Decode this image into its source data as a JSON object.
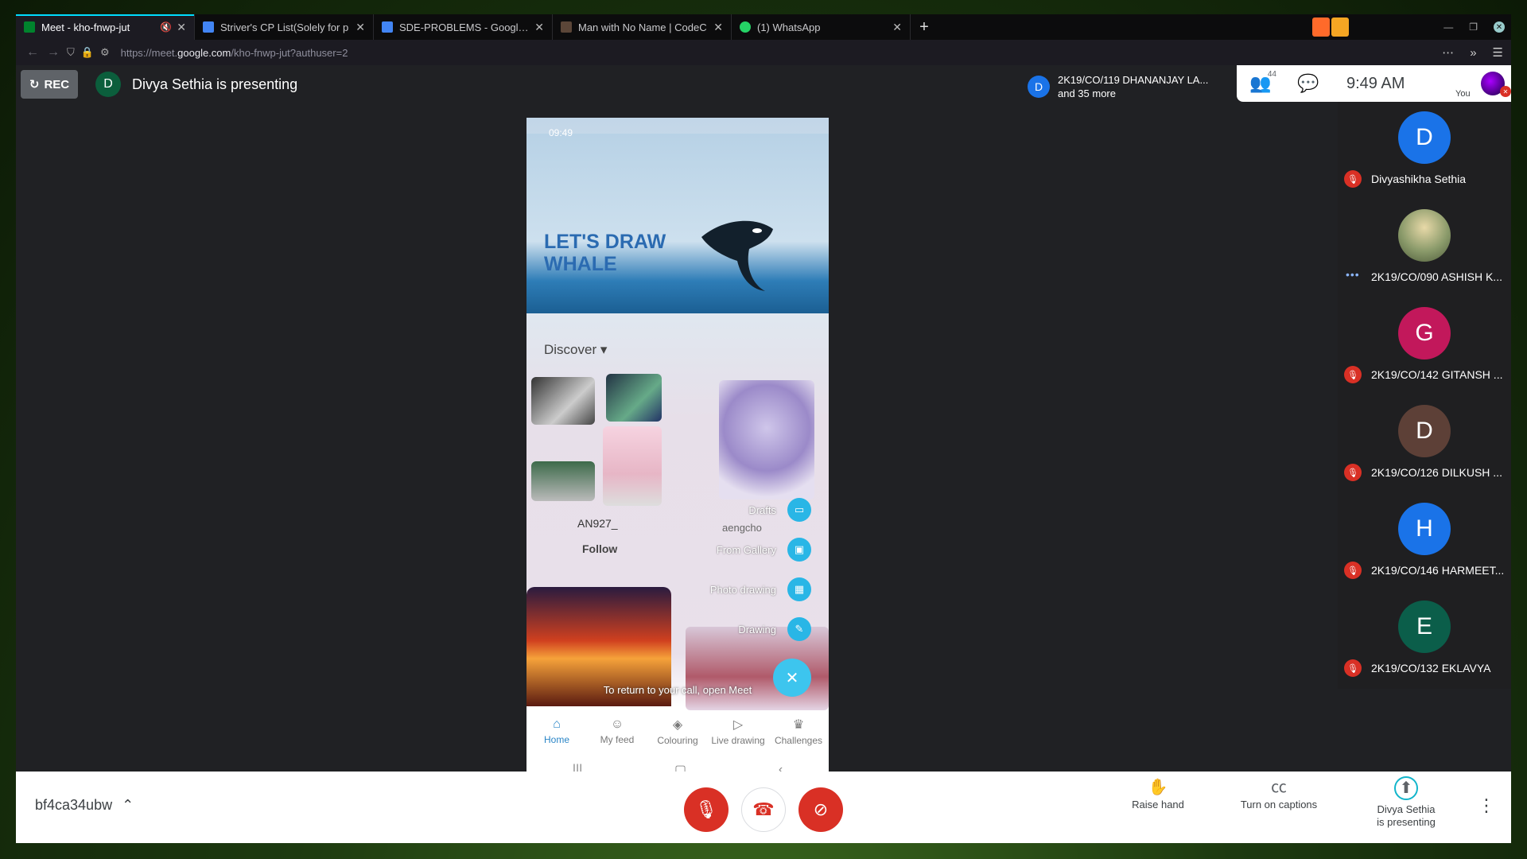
{
  "browser": {
    "tabs": [
      {
        "title": "Meet - kho-fnwp-jut",
        "active": true,
        "favicon_color": "#00832d"
      },
      {
        "title": "Striver's CP List(Solely for p",
        "active": false,
        "favicon_color": "#4285f4"
      },
      {
        "title": "SDE-PROBLEMS - Google D",
        "active": false,
        "favicon_color": "#4285f4"
      },
      {
        "title": "Man with No Name | CodeC",
        "active": false,
        "favicon_color": "#5b4638"
      },
      {
        "title": "(1) WhatsApp",
        "active": false,
        "favicon_color": "#25d366"
      }
    ],
    "new_tab": "+",
    "url_prefix": "https://meet.",
    "url_domain": "google.com",
    "url_path": "/kho-fnwp-jut?authuser=2"
  },
  "meet": {
    "rec_label": "REC",
    "presenter_initial": "D",
    "presenting_text": "Divya Sethia is presenting",
    "participants_chip": {
      "initial": "D",
      "line1": "2K19/CO/119 DHANANJAY LA...",
      "line2": "and 35 more"
    },
    "people_count": "44",
    "clock": "9:49 AM",
    "self_label": "You"
  },
  "phone": {
    "status_time": "09:49",
    "banner_title": "LET'S DRAW WHALE",
    "discover": "Discover",
    "username": "AN927_",
    "follow": "Follow",
    "second_user": "aengcho",
    "fab_items": [
      "Drafts",
      "From Gallery",
      "Photo drawing",
      "Drawing"
    ],
    "toast": "To return to your call, open Meet",
    "nav": [
      "Home",
      "My feed",
      "Colouring",
      "Live drawing",
      "Challenges"
    ]
  },
  "participants": [
    {
      "initial": "D",
      "name": "Divyashikha Sethia",
      "color": "#1a73e8",
      "status": "muted"
    },
    {
      "initial": "",
      "name": "2K19/CO/090 ASHISH K...",
      "color": "#8a9a6a",
      "status": "speaking"
    },
    {
      "initial": "G",
      "name": "2K19/CO/142 GITANSH ...",
      "color": "#c2185b",
      "status": "muted"
    },
    {
      "initial": "D",
      "name": "2K19/CO/126 DILKUSH ...",
      "color": "#5d4037",
      "status": "muted"
    },
    {
      "initial": "H",
      "name": "2K19/CO/146 HARMEET...",
      "color": "#1a73e8",
      "status": "muted"
    },
    {
      "initial": "E",
      "name": "2K19/CO/132 EKLAVYA",
      "color": "#0b5e4a",
      "status": "muted"
    }
  ],
  "controls": {
    "meeting_code": "bf4ca34ubw",
    "raise_hand": "Raise hand",
    "captions": "Turn on captions",
    "presenting_line1": "Divya Sethia",
    "presenting_line2": "is presenting"
  }
}
